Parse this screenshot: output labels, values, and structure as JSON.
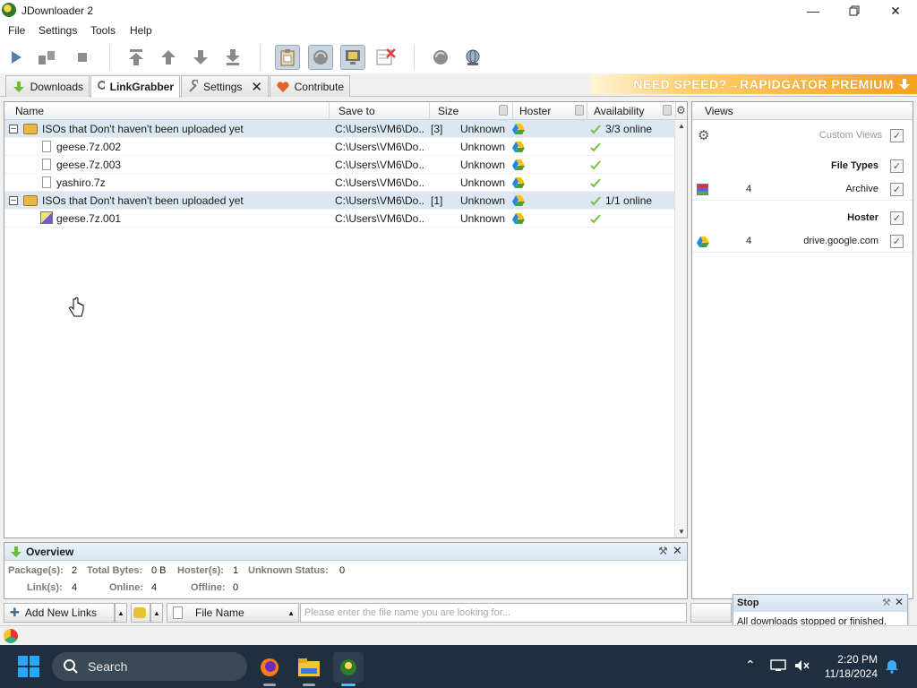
{
  "window": {
    "title": "JDownloader 2"
  },
  "menu": [
    "File",
    "Settings",
    "Tools",
    "Help"
  ],
  "tabs": [
    {
      "label": "Downloads"
    },
    {
      "label": "LinkGrabber"
    },
    {
      "label": "Settings"
    },
    {
      "label": "Contribute"
    }
  ],
  "promo": {
    "text": "NEED SPEED?→RAPIDGATOR PREMIUM"
  },
  "table": {
    "columns": [
      "Name",
      "Save to",
      "Size",
      "Hoster",
      "Availability"
    ],
    "rows": [
      {
        "type": "package",
        "name": "ISOs that Don't haven't been uploaded yet",
        "save_to": "C:\\Users\\VM6\\Do...",
        "count": "[3]",
        "size": "Unknown",
        "availability": "3/3 online"
      },
      {
        "type": "file",
        "name": "geese.7z.002",
        "save_to": "C:\\Users\\VM6\\Do...",
        "count": "",
        "size": "Unknown",
        "availability": ""
      },
      {
        "type": "file",
        "name": "geese.7z.003",
        "save_to": "C:\\Users\\VM6\\Do...",
        "count": "",
        "size": "Unknown",
        "availability": ""
      },
      {
        "type": "file",
        "name": "yashiro.7z",
        "save_to": "C:\\Users\\VM6\\Do...",
        "count": "",
        "size": "Unknown",
        "availability": ""
      },
      {
        "type": "package",
        "name": "ISOs that Don't haven't been uploaded yet",
        "save_to": "C:\\Users\\VM6\\Do...",
        "count": "[1]",
        "size": "Unknown",
        "availability": "1/1 online"
      },
      {
        "type": "file",
        "name": "geese.7z.001",
        "save_to": "C:\\Users\\VM6\\Do...",
        "count": "",
        "size": "Unknown",
        "availability": ""
      }
    ]
  },
  "views": {
    "title": "Views",
    "custom_views": "Custom Views",
    "file_types": "File Types",
    "archive_count": "4",
    "archive_label": "Archive",
    "hoster": "Hoster",
    "hoster_count": "4",
    "hoster_label": "drive.google.com"
  },
  "overview": {
    "title": "Overview",
    "packages_label": "Package(s):",
    "packages": "2",
    "total_bytes_label": "Total Bytes:",
    "total_bytes": "0 B",
    "hosters_label": "Hoster(s):",
    "hosters": "1",
    "unknown_label": "Unknown Status:",
    "unknown": "0",
    "links_label": "Link(s):",
    "links": "4",
    "online_label": "Online:",
    "online": "4",
    "offline_label": "Offline:",
    "offline": "0"
  },
  "bottom": {
    "add_links": "Add New Links",
    "filter_field": "File Name",
    "search_placeholder": "Please enter the file name you are looking for..."
  },
  "notification": {
    "title": "Stop",
    "text": "All downloads stopped or finished."
  },
  "taskbar": {
    "search": "Search",
    "time": "2:20 PM",
    "date": "11/18/2024"
  },
  "colors": {
    "package_row": "#dde7f1",
    "check_green": "#7bc043",
    "taskbar": "#1f2f3f"
  }
}
